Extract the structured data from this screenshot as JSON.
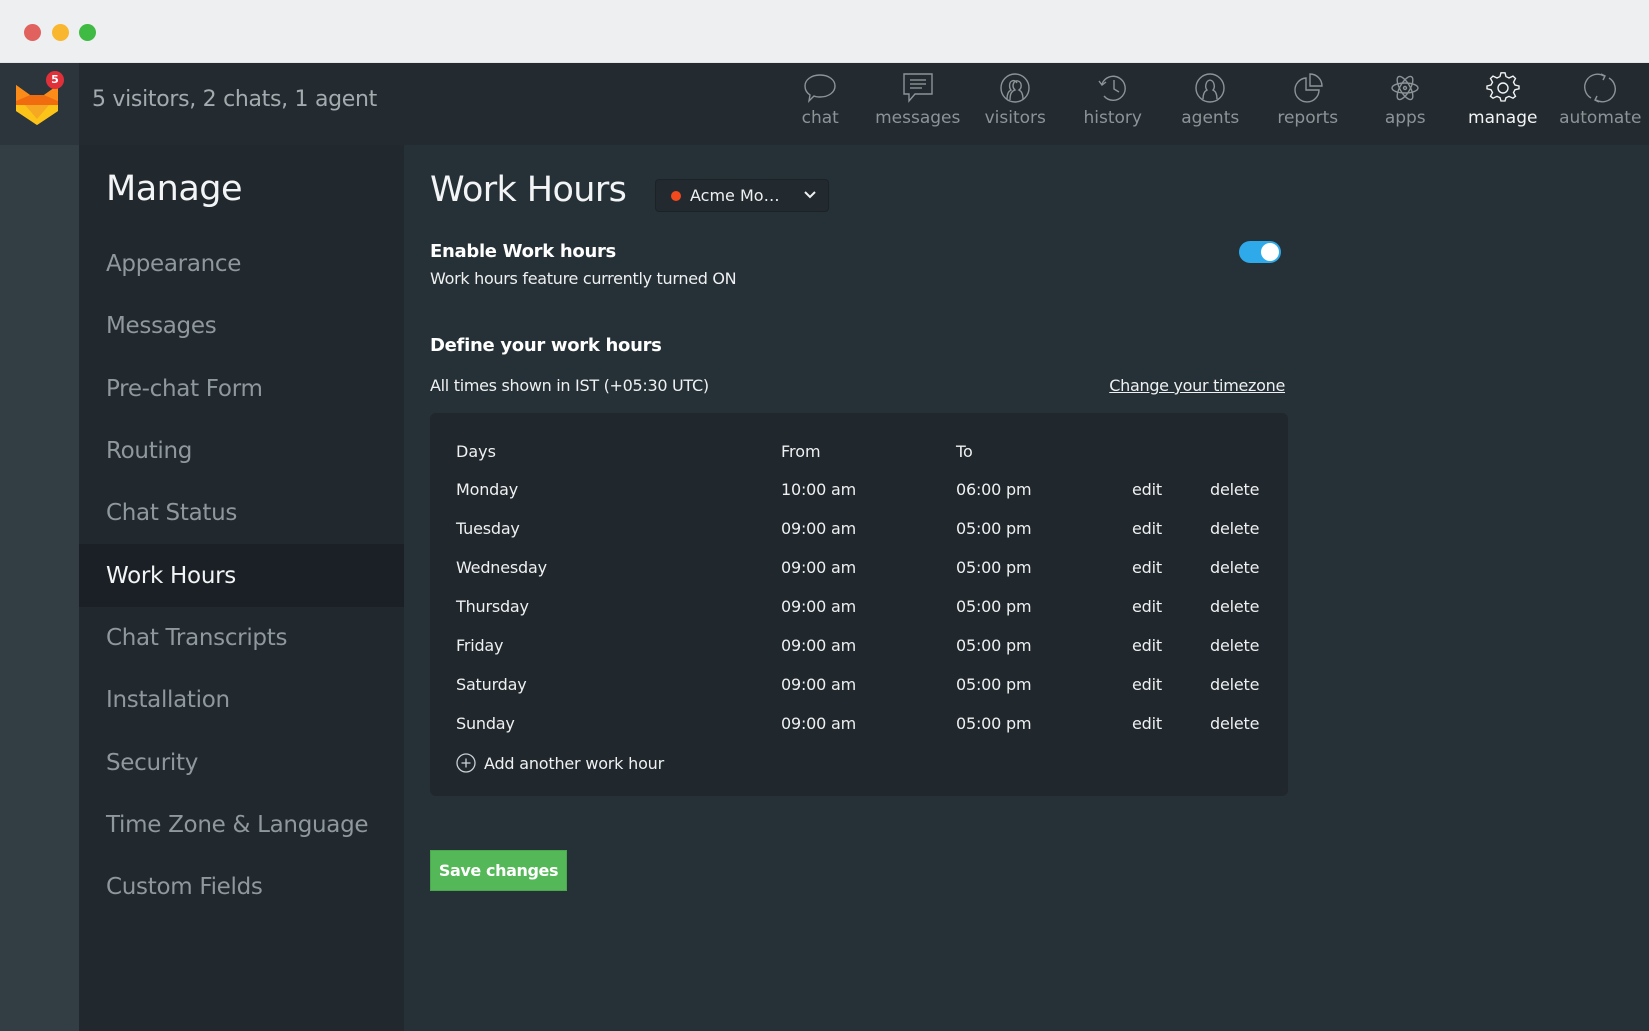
{
  "window": {
    "controls": [
      "close",
      "minimize",
      "maximize"
    ]
  },
  "appbar": {
    "logo_icon": "fox-logo-icon",
    "notification_count": "5",
    "status_summary": "5 visitors, 2 chats, 1 agent",
    "nav": [
      {
        "id": "chat",
        "label": "chat",
        "icon": "speech-bubble-icon",
        "active": false
      },
      {
        "id": "messages",
        "label": "messages",
        "icon": "message-lines-icon",
        "active": false
      },
      {
        "id": "visitors",
        "label": "visitors",
        "icon": "visitors-icon",
        "active": false
      },
      {
        "id": "history",
        "label": "history",
        "icon": "clock-history-icon",
        "active": false
      },
      {
        "id": "agents",
        "label": "agents",
        "icon": "agent-person-icon",
        "active": false
      },
      {
        "id": "reports",
        "label": "reports",
        "icon": "pie-chart-icon",
        "active": false
      },
      {
        "id": "apps",
        "label": "apps",
        "icon": "atom-icon",
        "active": false
      },
      {
        "id": "manage",
        "label": "manage",
        "icon": "gear-icon",
        "active": true
      },
      {
        "id": "automate",
        "label": "automate",
        "icon": "refresh-cycle-icon",
        "active": false
      }
    ]
  },
  "sidebar": {
    "title": "Manage",
    "items": [
      {
        "label": "Appearance",
        "active": false
      },
      {
        "label": "Messages",
        "active": false
      },
      {
        "label": "Pre-chat Form",
        "active": false
      },
      {
        "label": "Routing",
        "active": false
      },
      {
        "label": "Chat Status",
        "active": false
      },
      {
        "label": "Work Hours",
        "active": true
      },
      {
        "label": "Chat Transcripts",
        "active": false
      },
      {
        "label": "Installation",
        "active": false
      },
      {
        "label": "Security",
        "active": false
      },
      {
        "label": "Time Zone & Language",
        "active": false
      },
      {
        "label": "Custom Fields",
        "active": false
      }
    ]
  },
  "main": {
    "title": "Work Hours",
    "site_selector": {
      "value": "Acme Mo…",
      "status_color": "#f24a1d"
    },
    "enable": {
      "title": "Enable Work hours",
      "description": "Work hours feature currently turned ON",
      "toggle_on": true
    },
    "define": {
      "title": "Define your work hours",
      "timezone_text": "All times shown in IST (+05:30 UTC)",
      "change_timezone_link": "Change your timezone"
    },
    "table": {
      "headers": {
        "days": "Days",
        "from": "From",
        "to": "To"
      },
      "rows": [
        {
          "day": "Monday",
          "from": "10:00 am",
          "to": "06:00 pm",
          "edit": "edit",
          "delete": "delete"
        },
        {
          "day": "Tuesday",
          "from": "09:00 am",
          "to": "05:00 pm",
          "edit": "edit",
          "delete": "delete"
        },
        {
          "day": "Wednesday",
          "from": "09:00 am",
          "to": "05:00 pm",
          "edit": "edit",
          "delete": "delete"
        },
        {
          "day": "Thursday",
          "from": "09:00 am",
          "to": "05:00 pm",
          "edit": "edit",
          "delete": "delete"
        },
        {
          "day": "Friday",
          "from": "09:00 am",
          "to": "05:00 pm",
          "edit": "edit",
          "delete": "delete"
        },
        {
          "day": "Saturday",
          "from": "09:00 am",
          "to": "05:00 pm",
          "edit": "edit",
          "delete": "delete"
        },
        {
          "day": "Sunday",
          "from": "09:00 am",
          "to": "05:00 pm",
          "edit": "edit",
          "delete": "delete"
        }
      ],
      "add_label": "Add another work hour"
    },
    "save_label": "Save changes"
  },
  "colors": {
    "accent_toggle": "#2ea9ea",
    "save_green": "#55b858",
    "badge_red": "#e0313a"
  }
}
